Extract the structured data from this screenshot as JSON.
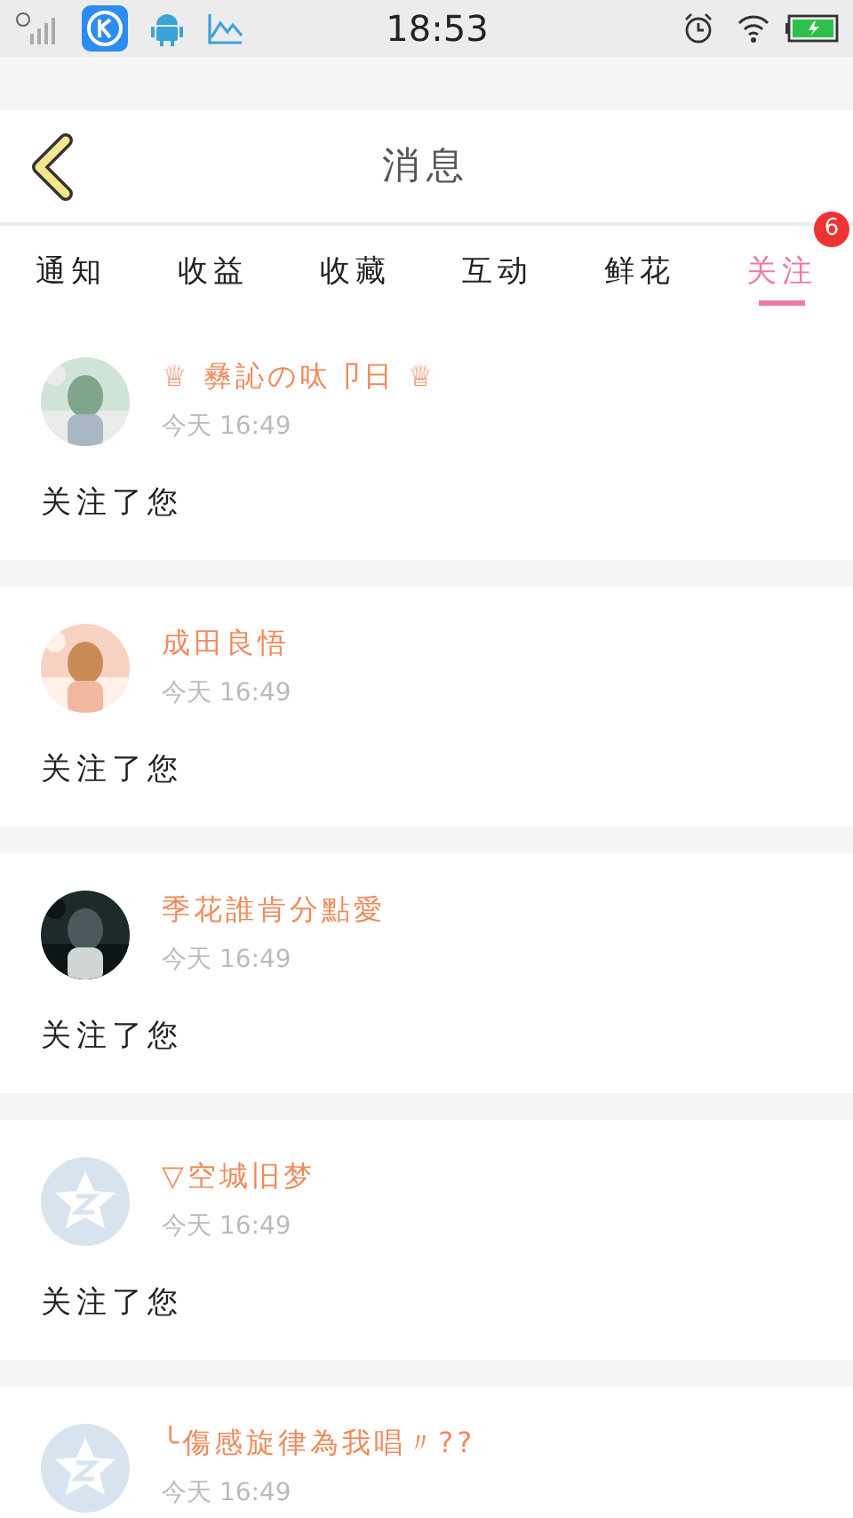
{
  "status_bar": {
    "time": "18:53"
  },
  "header": {
    "title": "消息"
  },
  "tabs": [
    {
      "label": "通知",
      "selected": false
    },
    {
      "label": "收益",
      "selected": false
    },
    {
      "label": "收藏",
      "selected": false
    },
    {
      "label": "互动",
      "selected": false
    },
    {
      "label": "鲜花",
      "selected": false
    },
    {
      "label": "关注",
      "selected": true,
      "badge": "6"
    }
  ],
  "messages": [
    {
      "name": "♕ 彝訫の呔卩日 ♕",
      "time": "今天 16:49",
      "text": "关注了您"
    },
    {
      "name": "成田良悟",
      "time": "今天 16:49",
      "text": "关注了您"
    },
    {
      "name": "季花誰肯分點愛",
      "time": "今天 16:49",
      "text": "关注了您"
    },
    {
      "avatar": {
        "kind": "default"
      },
      "name": "▽空城旧梦",
      "time": "今天 16:49",
      "text": "关注了您"
    },
    {
      "avatar": {
        "kind": "default"
      },
      "name": "╰傷感旋律為我唱〃??",
      "time": "今天 16:49"
    }
  ]
}
